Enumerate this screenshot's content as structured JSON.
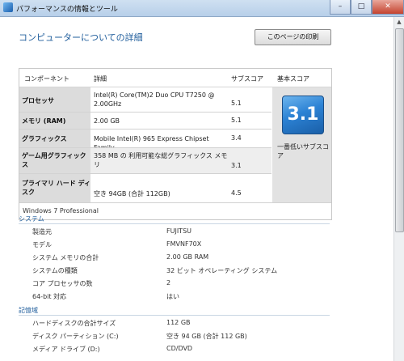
{
  "window": {
    "title": "パフォーマンスの情報とツール",
    "min": "–",
    "max": "□",
    "close": "✕"
  },
  "page": {
    "title": "コンピューターについての詳細",
    "print_button": "このページの印刷"
  },
  "rating": {
    "headers": {
      "component": "コンポーネント",
      "detail": "詳細",
      "subscore": "サブスコア",
      "base": "基本スコア"
    },
    "rows": [
      {
        "label": "プロセッサ",
        "detail": "Intel(R) Core(TM)2 Duo CPU T7250 @ 2.00GHz",
        "score": "5.1"
      },
      {
        "label": "メモリ (RAM)",
        "detail": "2.00 GB",
        "score": "5.1"
      },
      {
        "label": "グラフィックス",
        "detail": "Mobile Intel(R) 965 Express Chipset Family",
        "score": "3.4"
      },
      {
        "label": "ゲーム用グラフィックス",
        "detail": "358 MB の 利用可能な総グラフィックス メモリ",
        "score": "3.1"
      },
      {
        "label": "プライマリ ハード ディスク",
        "detail": "空き 94GB (合計 112GB)",
        "score": "4.5"
      }
    ],
    "base_score": "3.1",
    "base_caption": "一番低いサブスコア",
    "edition": "Windows 7 Professional"
  },
  "system": {
    "title": "システム",
    "items": [
      {
        "key": "製造元",
        "value": "FUJITSU"
      },
      {
        "key": "モデル",
        "value": "FMVNF70X"
      },
      {
        "key": "システム メモリの合計",
        "value": "2.00 GB RAM"
      },
      {
        "key": "システムの種類",
        "value": "32 ビット オペレーティング システム"
      },
      {
        "key": "コア プロセッサの数",
        "value": "2"
      },
      {
        "key": "64-bit 対応",
        "value": "はい"
      }
    ]
  },
  "storage": {
    "title": "記憶域",
    "items": [
      {
        "key": "ハードディスクの合計サイズ",
        "value": "112 GB"
      },
      {
        "key": "ディスク パーティション (C:)",
        "value": "空き 94 GB (合計 112 GB)"
      },
      {
        "key": "メディア ドライブ (D:)",
        "value": "CD/DVD"
      }
    ]
  }
}
